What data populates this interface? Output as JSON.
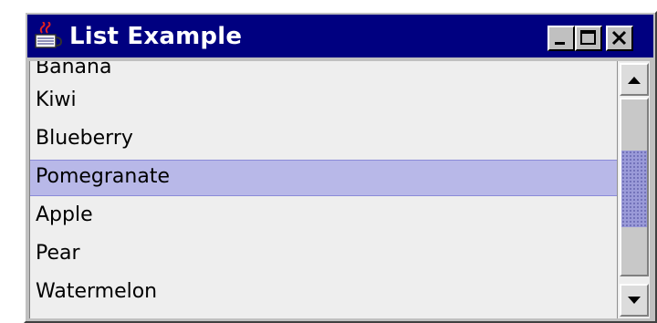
{
  "window": {
    "title": "List Example"
  },
  "title_buttons": {
    "minimize_icon": "minimize-icon",
    "maximize_icon": "maximize-icon",
    "close_icon": "close-icon"
  },
  "list": {
    "items": [
      {
        "label": "Banana",
        "selected": false
      },
      {
        "label": "Kiwi",
        "selected": false
      },
      {
        "label": "Blueberry",
        "selected": false
      },
      {
        "label": "Pomegranate",
        "selected": true
      },
      {
        "label": "Apple",
        "selected": false
      },
      {
        "label": "Pear",
        "selected": false
      },
      {
        "label": "Watermelon",
        "selected": false
      }
    ]
  },
  "colors": {
    "titlebar": "#000080",
    "selection": "#b8b8e8",
    "list_background": "#eeeeee"
  }
}
